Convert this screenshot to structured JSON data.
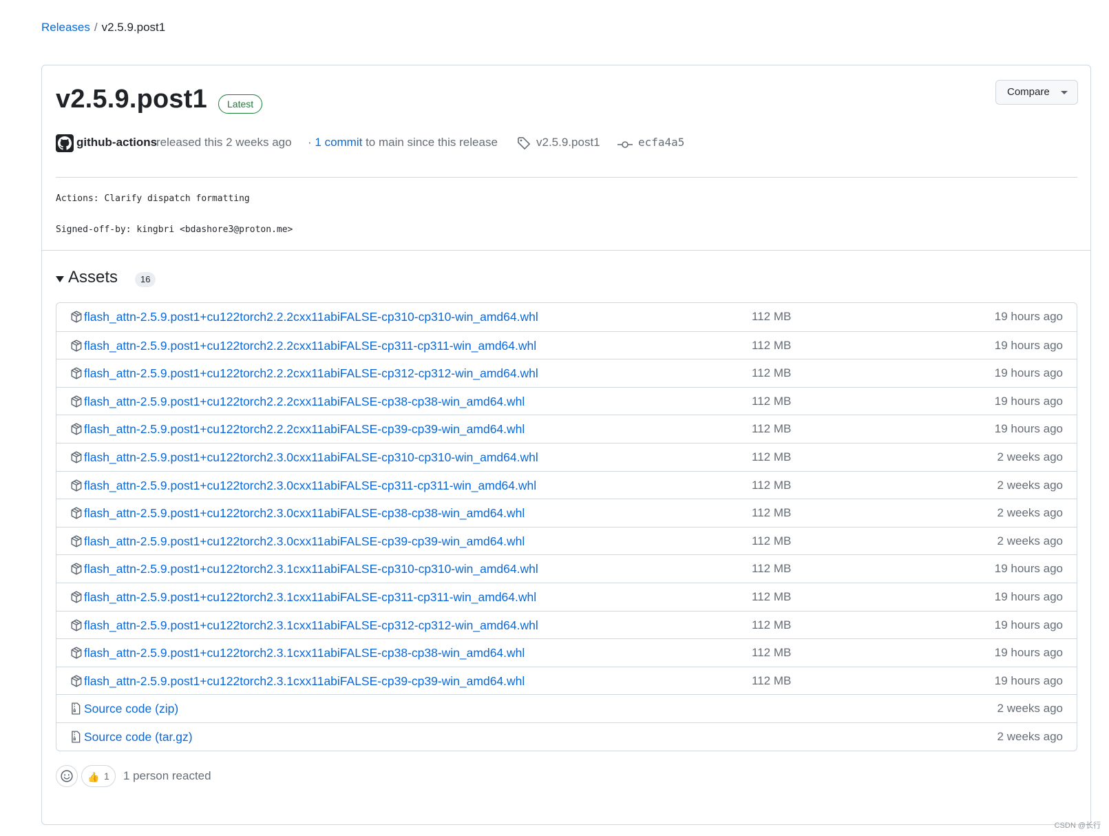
{
  "breadcrumb": {
    "root": "Releases",
    "separator": "/",
    "current": "v2.5.9.post1"
  },
  "release": {
    "title": "v2.5.9.post1",
    "badge": "Latest",
    "compare_label": "Compare",
    "author": "github-actions",
    "released_text": "released this 2 weeks ago",
    "commit_prefix": "· ",
    "commit_link": "1 commit",
    "commit_suffix": " to main since this release",
    "tag": "v2.5.9.post1",
    "commit_sha": "ecfa4a5",
    "body_lines": [
      "Actions: Clarify dispatch formatting",
      "Signed-off-by: kingbri <bdashore3@proton.me>"
    ]
  },
  "assets": {
    "title": "Assets",
    "count": "16",
    "items": [
      {
        "name": "flash_attn-2.5.9.post1+cu122torch2.2.2cxx11abiFALSE-cp310-cp310-win_amd64.whl",
        "size": "112 MB",
        "time": "19 hours ago"
      },
      {
        "name": "flash_attn-2.5.9.post1+cu122torch2.2.2cxx11abiFALSE-cp311-cp311-win_amd64.whl",
        "size": "112 MB",
        "time": "19 hours ago"
      },
      {
        "name": "flash_attn-2.5.9.post1+cu122torch2.2.2cxx11abiFALSE-cp312-cp312-win_amd64.whl",
        "size": "112 MB",
        "time": "19 hours ago"
      },
      {
        "name": "flash_attn-2.5.9.post1+cu122torch2.2.2cxx11abiFALSE-cp38-cp38-win_amd64.whl",
        "size": "112 MB",
        "time": "19 hours ago"
      },
      {
        "name": "flash_attn-2.5.9.post1+cu122torch2.2.2cxx11abiFALSE-cp39-cp39-win_amd64.whl",
        "size": "112 MB",
        "time": "19 hours ago"
      },
      {
        "name": "flash_attn-2.5.9.post1+cu122torch2.3.0cxx11abiFALSE-cp310-cp310-win_amd64.whl",
        "size": "112 MB",
        "time": "2 weeks ago"
      },
      {
        "name": "flash_attn-2.5.9.post1+cu122torch2.3.0cxx11abiFALSE-cp311-cp311-win_amd64.whl",
        "size": "112 MB",
        "time": "2 weeks ago"
      },
      {
        "name": "flash_attn-2.5.9.post1+cu122torch2.3.0cxx11abiFALSE-cp38-cp38-win_amd64.whl",
        "size": "112 MB",
        "time": "2 weeks ago"
      },
      {
        "name": "flash_attn-2.5.9.post1+cu122torch2.3.0cxx11abiFALSE-cp39-cp39-win_amd64.whl",
        "size": "112 MB",
        "time": "2 weeks ago"
      },
      {
        "name": "flash_attn-2.5.9.post1+cu122torch2.3.1cxx11abiFALSE-cp310-cp310-win_amd64.whl",
        "size": "112 MB",
        "time": "19 hours ago"
      },
      {
        "name": "flash_attn-2.5.9.post1+cu122torch2.3.1cxx11abiFALSE-cp311-cp311-win_amd64.whl",
        "size": "112 MB",
        "time": "19 hours ago"
      },
      {
        "name": "flash_attn-2.5.9.post1+cu122torch2.3.1cxx11abiFALSE-cp312-cp312-win_amd64.whl",
        "size": "112 MB",
        "time": "19 hours ago"
      },
      {
        "name": "flash_attn-2.5.9.post1+cu122torch2.3.1cxx11abiFALSE-cp38-cp38-win_amd64.whl",
        "size": "112 MB",
        "time": "19 hours ago"
      },
      {
        "name": "flash_attn-2.5.9.post1+cu122torch2.3.1cxx11abiFALSE-cp39-cp39-win_amd64.whl",
        "size": "112 MB",
        "time": "19 hours ago"
      },
      {
        "name": "Source code",
        "suffix": " (zip)",
        "size": "",
        "time": "2 weeks ago",
        "icon": "file-zip-icon"
      },
      {
        "name": "Source code",
        "suffix": " (tar.gz)",
        "size": "",
        "time": "2 weeks ago",
        "icon": "file-zip-icon"
      }
    ]
  },
  "reactions": {
    "thumbs_emoji": "👍",
    "thumbs_count": "1",
    "summary": "1 person reacted"
  },
  "watermark": "CSDN @长行",
  "colors": {
    "link": "#0969da",
    "latest": "#1a7f37",
    "border": "#d0d7de",
    "muted": "#656d76"
  }
}
